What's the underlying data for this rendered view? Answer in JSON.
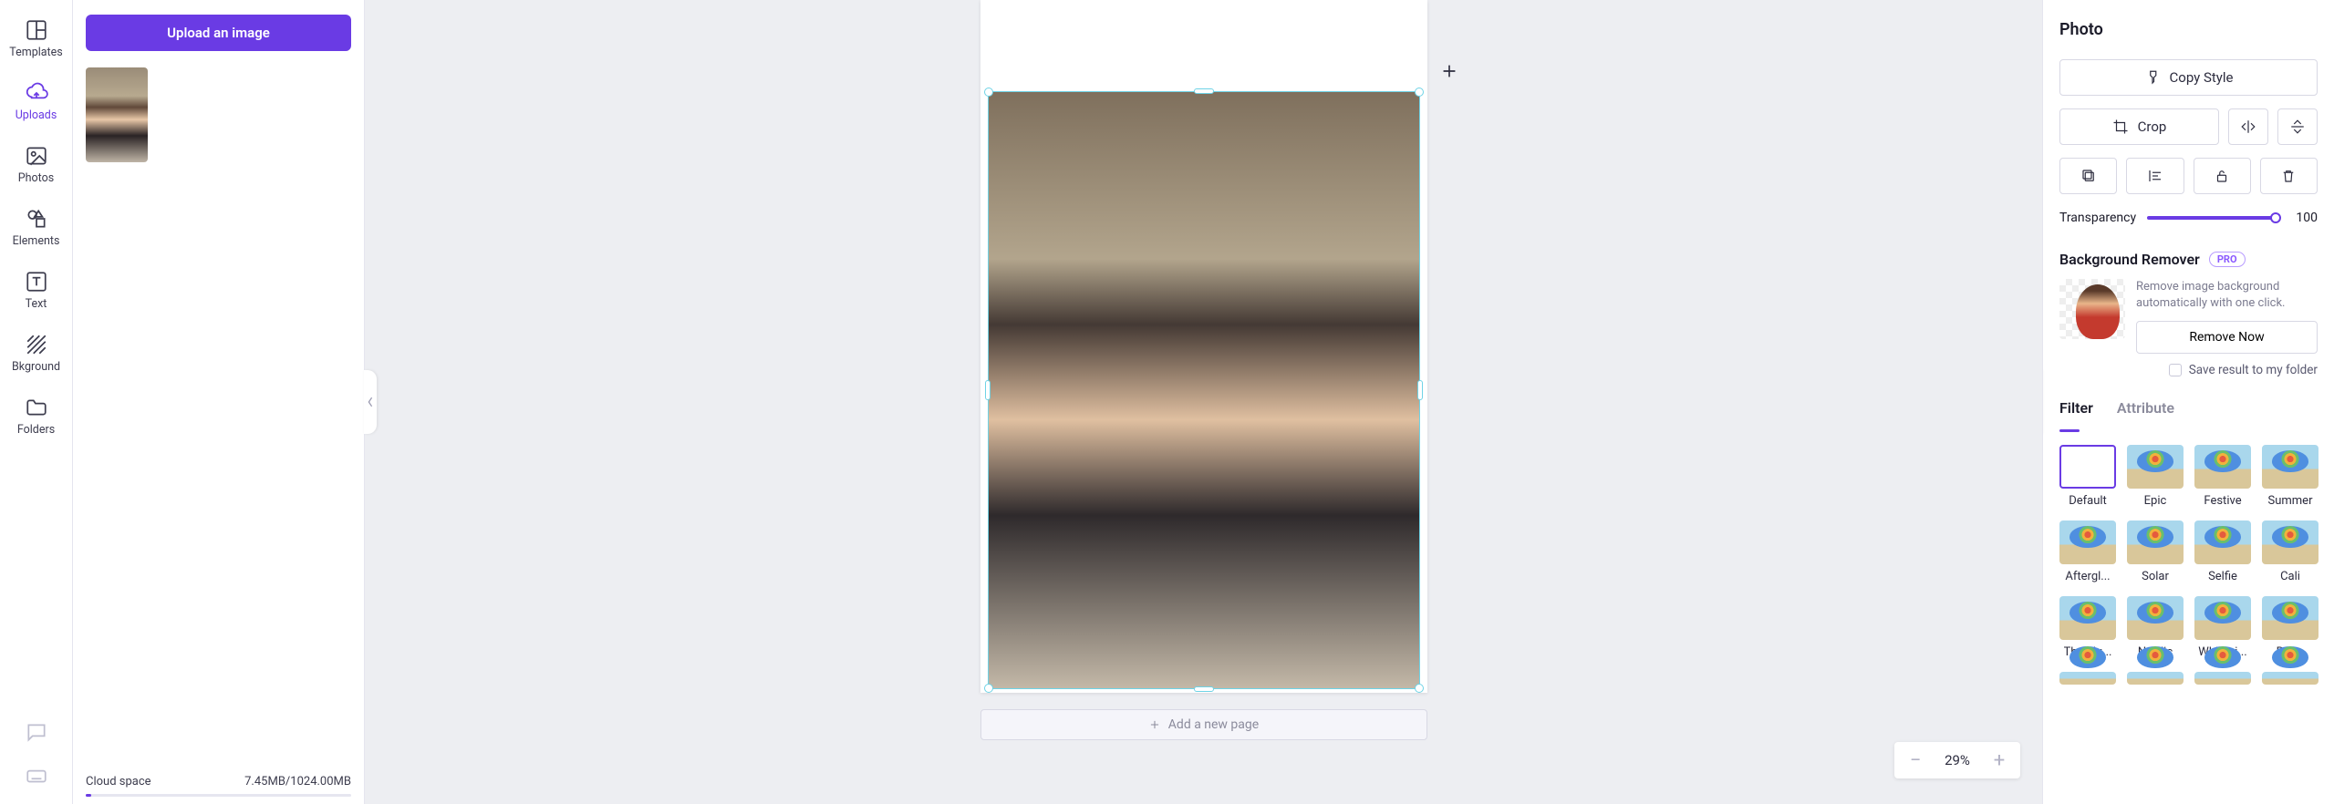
{
  "rail": {
    "templates": "Templates",
    "uploads": "Uploads",
    "photos": "Photos",
    "elements": "Elements",
    "text": "Text",
    "bkground": "Bkground",
    "folders": "Folders"
  },
  "uploads_panel": {
    "upload_btn": "Upload an image",
    "cloud_label": "Cloud space",
    "cloud_usage": "7.45MB/1024.00MB"
  },
  "canvas": {
    "add_page": "Add a new page",
    "zoom": "29%"
  },
  "inspector": {
    "title": "Photo",
    "copy_style": "Copy Style",
    "crop": "Crop",
    "transparency_label": "Transparency",
    "transparency_value": "100",
    "bgr_title": "Background Remover",
    "pro": "PRO",
    "bgr_desc": "Remove image background automatically with one click.",
    "remove_now": "Remove Now",
    "save_result": "Save result to my folder",
    "tab_filter": "Filter",
    "tab_attribute": "Attribute",
    "filters": [
      "Default",
      "Epic",
      "Festive",
      "Summer",
      "Aftergl...",
      "Solar",
      "Selfie",
      "Cali",
      "The blu...",
      "Nordic",
      "Whimsi...",
      "Retro"
    ]
  }
}
